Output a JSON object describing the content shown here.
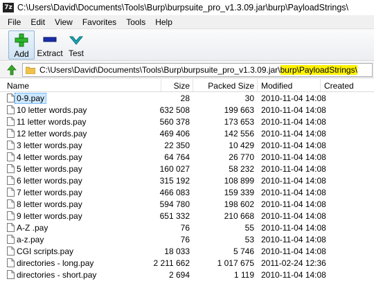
{
  "window": {
    "app_icon_text": "7z",
    "title": "C:\\Users\\David\\Documents\\Tools\\Burp\\burpsuite_pro_v1.3.09.jar\\burp\\PayloadStrings\\"
  },
  "menu": [
    "File",
    "Edit",
    "View",
    "Favorites",
    "Tools",
    "Help"
  ],
  "toolbar": {
    "add_label": "Add",
    "extract_label": "Extract",
    "test_label": "Test",
    "colors": {
      "add": "#2bb52b",
      "extract": "#1a2fa8",
      "test": "#1aa9b5"
    }
  },
  "address": {
    "path_plain": "C:\\Users\\David\\Documents\\Tools\\Burp\\burpsuite_pro_v1.3.09.jar\\",
    "path_highlighted": "burp\\PayloadStrings\\",
    "highlight_color": "#fff200"
  },
  "columns": {
    "name": "Name",
    "size": "Size",
    "packed": "Packed Size",
    "modified": "Modified",
    "created": "Created"
  },
  "files": [
    {
      "name": "0-9.pay",
      "size": "28",
      "packed": "30",
      "modified": "2010-11-04 14:08"
    },
    {
      "name": "10 letter words.pay",
      "size": "632 508",
      "packed": "199 663",
      "modified": "2010-11-04 14:08"
    },
    {
      "name": "11 letter words.pay",
      "size": "560 378",
      "packed": "173 653",
      "modified": "2010-11-04 14:08"
    },
    {
      "name": "12 letter words.pay",
      "size": "469 406",
      "packed": "142 556",
      "modified": "2010-11-04 14:08"
    },
    {
      "name": "3 letter words.pay",
      "size": "22 350",
      "packed": "10 429",
      "modified": "2010-11-04 14:08"
    },
    {
      "name": "4 letter words.pay",
      "size": "64 764",
      "packed": "26 770",
      "modified": "2010-11-04 14:08"
    },
    {
      "name": "5 letter words.pay",
      "size": "160 027",
      "packed": "58 232",
      "modified": "2010-11-04 14:08"
    },
    {
      "name": "6 letter words.pay",
      "size": "315 192",
      "packed": "108 899",
      "modified": "2010-11-04 14:08"
    },
    {
      "name": "7 letter words.pay",
      "size": "466 083",
      "packed": "159 339",
      "modified": "2010-11-04 14:08"
    },
    {
      "name": "8 letter words.pay",
      "size": "594 780",
      "packed": "198 602",
      "modified": "2010-11-04 14:08"
    },
    {
      "name": "9 letter words.pay",
      "size": "651 332",
      "packed": "210 668",
      "modified": "2010-11-04 14:08"
    },
    {
      "name": "A-Z .pay",
      "size": "76",
      "packed": "55",
      "modified": "2010-11-04 14:08"
    },
    {
      "name": "a-z.pay",
      "size": "76",
      "packed": "53",
      "modified": "2010-11-04 14:08"
    },
    {
      "name": "CGI scripts.pay",
      "size": "18 033",
      "packed": "5 746",
      "modified": "2010-11-04 14:08"
    },
    {
      "name": "directories - long.pay",
      "size": "2 211 662",
      "packed": "1 017 675",
      "modified": "2011-02-24 12:36"
    },
    {
      "name": "directories - short.pay",
      "size": "2 694",
      "packed": "1 119",
      "modified": "2010-11-04 14:08"
    }
  ],
  "selected_index": 0
}
